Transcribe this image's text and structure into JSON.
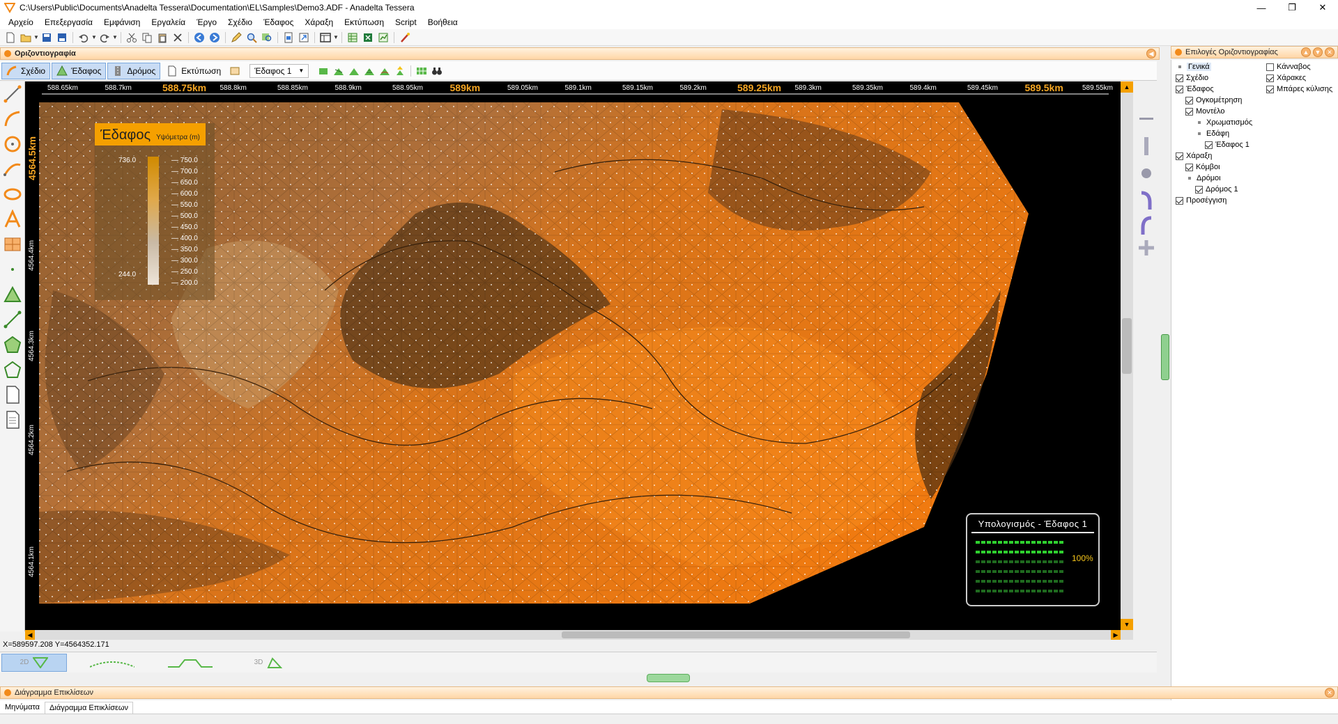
{
  "window": {
    "title": "C:\\Users\\Public\\Documents\\Anadelta Tessera\\Documentation\\EL\\Samples\\Demo3.ADF - Anadelta Tessera",
    "minimize": "—",
    "maximize": "❐",
    "close": "✕"
  },
  "menu": [
    "Αρχείο",
    "Επεξεργασία",
    "Εμφάνιση",
    "Εργαλεία",
    "Έργο",
    "Σχέδιο",
    "Έδαφος",
    "Χάραξη",
    "Εκτύπωση",
    "Script",
    "Βοήθεια"
  ],
  "panel_main": {
    "title": "Οριζοντιογραφία"
  },
  "ribbon": {
    "tabs": [
      "Σχέδιο",
      "Έδαφος",
      "Δρόμος",
      "Εκτύπωση"
    ],
    "terrain_select": "Έδαφος 1"
  },
  "ruler_top": [
    {
      "label": "588.65km",
      "big": false
    },
    {
      "label": "588.7km",
      "big": false
    },
    {
      "label": "588.75km",
      "big": true
    },
    {
      "label": "588.8km",
      "big": false
    },
    {
      "label": "588.85km",
      "big": false
    },
    {
      "label": "588.9km",
      "big": false
    },
    {
      "label": "588.95km",
      "big": false
    },
    {
      "label": "589km",
      "big": true
    },
    {
      "label": "589.05km",
      "big": false
    },
    {
      "label": "589.1km",
      "big": false
    },
    {
      "label": "589.15km",
      "big": false
    },
    {
      "label": "589.2km",
      "big": false
    },
    {
      "label": "589.25km",
      "big": true
    },
    {
      "label": "589.3km",
      "big": false
    },
    {
      "label": "589.35km",
      "big": false
    },
    {
      "label": "589.4km",
      "big": false
    },
    {
      "label": "589.45km",
      "big": false
    },
    {
      "label": "589.5km",
      "big": true
    },
    {
      "label": "589.55km",
      "big": false
    }
  ],
  "ruler_left": [
    {
      "label": "4564.5km",
      "big": true
    },
    {
      "label": "4564.4km",
      "big": false
    },
    {
      "label": "4564.3km",
      "big": false
    },
    {
      "label": "4564.2km",
      "big": false
    },
    {
      "label": "4564.1km",
      "big": false
    }
  ],
  "legend": {
    "title": "Έδαφος",
    "subtitle": "Υψόμετρα (m)",
    "max_label": "736.0",
    "min_label": "244.0",
    "ticks": [
      "750.0",
      "700.0",
      "650.0",
      "600.0",
      "550.0",
      "500.0",
      "450.0",
      "400.0",
      "350.0",
      "300.0",
      "250.0",
      "200.0"
    ]
  },
  "progress": {
    "title": "Υπολογισμός - Έδαφος 1",
    "percent_label": "100%",
    "value": 1.0
  },
  "status": {
    "coords": "X=589597.208  Y=4564352.171"
  },
  "view_tabs": [
    "2D",
    "",
    "",
    "3D"
  ],
  "right_panel": {
    "title": "Επιλογές Οριζοντιογραφίας",
    "tree_left": [
      {
        "label": "Γενικά",
        "level": 0,
        "checkbox": false,
        "checked": false,
        "selected": true
      },
      {
        "label": "Σχέδιο",
        "level": 0,
        "checkbox": true,
        "checked": true
      },
      {
        "label": "Έδαφος",
        "level": 0,
        "checkbox": true,
        "checked": true
      },
      {
        "label": "Ογκομέτρηση",
        "level": 1,
        "checkbox": true,
        "checked": true
      },
      {
        "label": "Μοντέλο",
        "level": 1,
        "checkbox": true,
        "checked": true
      },
      {
        "label": "Χρωματισμός",
        "level": 2,
        "checkbox": false,
        "checked": false
      },
      {
        "label": "Εδάφη",
        "level": 2,
        "checkbox": false,
        "checked": false
      },
      {
        "label": "Έδαφος 1",
        "level": 3,
        "checkbox": true,
        "checked": true
      },
      {
        "label": "Χάραξη",
        "level": 0,
        "checkbox": true,
        "checked": true
      },
      {
        "label": "Κόμβοι",
        "level": 1,
        "checkbox": true,
        "checked": true
      },
      {
        "label": "Δρόμοι",
        "level": 1,
        "checkbox": false,
        "checked": false
      },
      {
        "label": "Δρόμος 1",
        "level": 2,
        "checkbox": true,
        "checked": true
      },
      {
        "label": "Προσέγγιση",
        "level": 0,
        "checkbox": true,
        "checked": true
      }
    ],
    "tree_right": [
      {
        "label": "Κάνναβος",
        "checked": false
      },
      {
        "label": "Χάρακες",
        "checked": true
      },
      {
        "label": "Μπάρες κύλισης",
        "checked": true
      }
    ]
  },
  "bottom_panel": {
    "title": "Διάγραμμα Επικλίσεων",
    "tabs": [
      "Μηνύματα",
      "Διάγραμμα Επικλίσεων"
    ]
  },
  "colors": {
    "accent": "#f5a623",
    "panel_header": "#ffd6a6",
    "terrain_dark": "#5a3a1a",
    "terrain_mid": "#b0602a",
    "terrain_bright": "#f07a10",
    "progress_green": "#2fd12f"
  }
}
